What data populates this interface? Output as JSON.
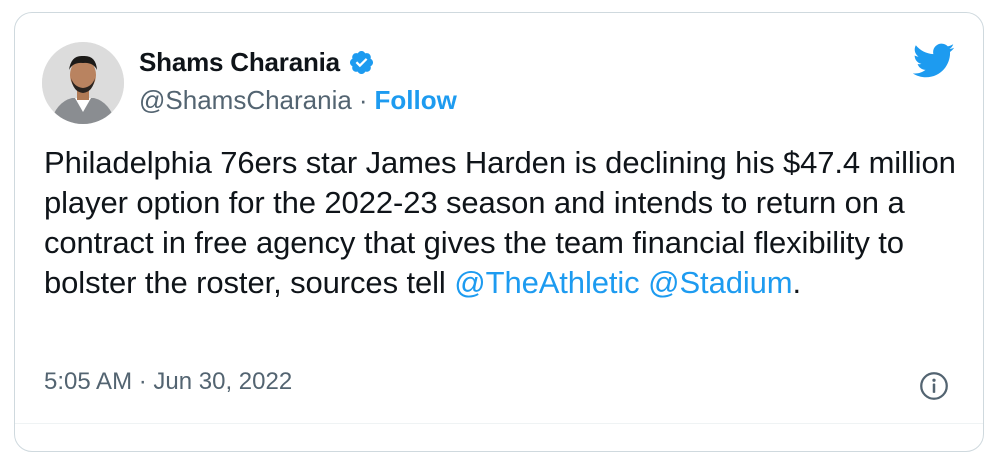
{
  "tweet": {
    "author": {
      "display_name": "Shams Charania",
      "handle": "@ShamsCharania",
      "separator": "·",
      "follow_label": "Follow",
      "verified_icon": "verified-badge-icon",
      "avatar_icon": "profile-photo"
    },
    "brand_icon": "twitter-bird-icon",
    "text": {
      "body": "Philadelphia 76ers star James Harden is declining his $47.4 million player option for the 2022-23 season and intends to return on a contract in free agency that gives the team financial flexibility to bolster the roster, sources tell ",
      "mention_1": "@TheAthletic",
      "space": " ",
      "mention_2": "@Stadium",
      "end": "."
    },
    "timestamp": "5:05 AM · Jun 30, 2022",
    "info_icon": "info-icon"
  },
  "colors": {
    "accent": "#1d9bf0",
    "text_primary": "#0f1419",
    "text_secondary": "#536471",
    "border": "#cfd9de"
  }
}
